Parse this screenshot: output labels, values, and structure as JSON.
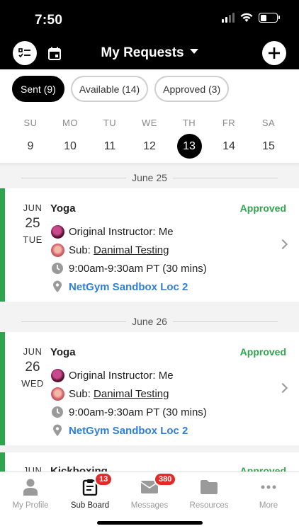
{
  "status_bar": {
    "time": "7:50"
  },
  "header": {
    "title": "My Requests"
  },
  "filters": [
    {
      "label": "Sent (9)",
      "active": true
    },
    {
      "label": "Available (14)",
      "active": false
    },
    {
      "label": "Approved (3)",
      "active": false
    }
  ],
  "week": [
    {
      "dow": "SU",
      "num": "9"
    },
    {
      "dow": "MO",
      "num": "10"
    },
    {
      "dow": "TU",
      "num": "11"
    },
    {
      "dow": "WE",
      "num": "12"
    },
    {
      "dow": "TH",
      "num": "13"
    },
    {
      "dow": "FR",
      "num": "14"
    },
    {
      "dow": "SA",
      "num": "15"
    }
  ],
  "selected_day": "13",
  "requests": [
    {
      "separator": "June 25",
      "month": "JUN",
      "day": "25",
      "weekday": "TUE",
      "class_name": "Yoga",
      "status": "Approved",
      "original_instructor": "Original Instructor: Me",
      "sub_prefix": "Sub: ",
      "sub_name": "Danimal Testing",
      "time": "9:00am-9:30am PT (30 mins)",
      "location": "NetGym Sandbox Loc 2"
    },
    {
      "separator": "June 26",
      "month": "JUN",
      "day": "26",
      "weekday": "WED",
      "class_name": "Yoga",
      "status": "Approved",
      "original_instructor": "Original Instructor: Me",
      "sub_prefix": "Sub: ",
      "sub_name": "Danimal Testing",
      "time": "9:00am-9:30am PT (30 mins)",
      "location": "NetGym Sandbox Loc 2"
    },
    {
      "month": "JUN",
      "class_name": "Kickboxing",
      "status": "Approved"
    }
  ],
  "tabbar": [
    {
      "label": "My Profile",
      "icon": "person-icon",
      "active": false
    },
    {
      "label": "Sub Board",
      "icon": "clipboard-icon",
      "active": true,
      "badge": "13"
    },
    {
      "label": "Messages",
      "icon": "envelope-icon",
      "active": false,
      "badge": "380"
    },
    {
      "label": "Resources",
      "icon": "folder-icon",
      "active": false
    },
    {
      "label": "More",
      "icon": "more-dots-icon",
      "active": false
    }
  ],
  "colors": {
    "accent_green": "#2ea44f",
    "link_blue": "#2f7fd6",
    "badge_red": "#e12b2b"
  }
}
